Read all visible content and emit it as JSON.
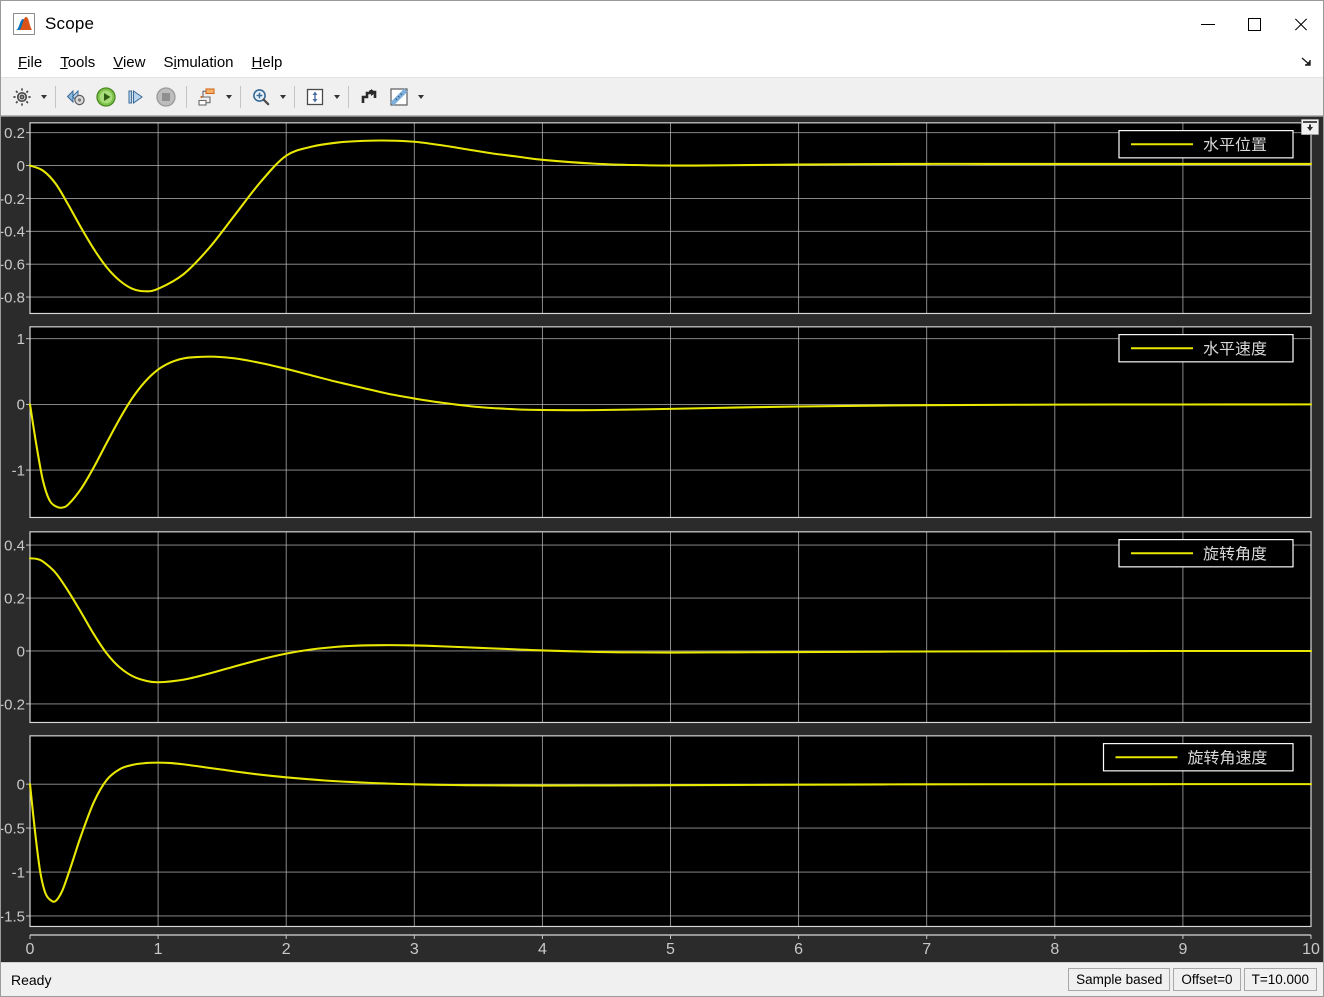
{
  "window": {
    "title": "Scope",
    "icon": "matlab-scope-icon",
    "controls": {
      "minimize": "minimize-button",
      "maximize": "maximize-button",
      "close": "close-button"
    }
  },
  "menubar": {
    "items": [
      {
        "label": "File",
        "mnemonic": "F"
      },
      {
        "label": "Tools",
        "mnemonic": "T"
      },
      {
        "label": "View",
        "mnemonic": "V"
      },
      {
        "label": "Simulation",
        "mnemonic": "S"
      },
      {
        "label": "Help",
        "mnemonic": "H"
      }
    ],
    "expand_icon": "menu-expand-arrow-icon"
  },
  "toolbar": {
    "buttons": [
      {
        "name": "configuration-properties-button",
        "icon": "gear-icon",
        "has_dropdown": true
      },
      {
        "name": "step-back-button",
        "icon": "rewind-gear-icon",
        "has_dropdown": false
      },
      {
        "name": "run-button",
        "icon": "play-icon",
        "has_dropdown": false
      },
      {
        "name": "step-forward-button",
        "icon": "step-forward-icon",
        "has_dropdown": false
      },
      {
        "name": "stop-button",
        "icon": "stop-icon",
        "has_dropdown": false
      },
      {
        "name": "signal-selection-button",
        "icon": "signal-blocks-icon",
        "has_dropdown": true
      },
      {
        "name": "zoom-button",
        "icon": "zoom-in-icon",
        "has_dropdown": true
      },
      {
        "name": "autoscale-button",
        "icon": "autoscale-icon",
        "has_dropdown": true
      },
      {
        "name": "scale-axes-limits-button",
        "icon": "axes-limits-icon",
        "has_dropdown": false
      },
      {
        "name": "cursor-measurements-button",
        "icon": "ruler-icon",
        "has_dropdown": true
      }
    ]
  },
  "statusbar": {
    "status": "Ready",
    "frame_mode": "Sample based",
    "offset": "Offset=0",
    "time": "T=10.000"
  },
  "scope": {
    "dock_icon": "dock-pin-icon",
    "background": "#000000",
    "surround": "#2b2b2b",
    "grid_color": "#b4b4b4",
    "trace_color": "#e8e800",
    "tick_text_color": "#c8c8c8"
  },
  "chart_data": [
    {
      "type": "line",
      "title": "",
      "xlabel": "",
      "ylabel": "",
      "legend": [
        "水平位置"
      ],
      "legend_position": "top-right",
      "grid": true,
      "xlim": [
        0,
        10
      ],
      "ylim": [
        -0.9,
        0.26
      ],
      "xticks": [
        0,
        1,
        2,
        3,
        4,
        5,
        6,
        7,
        8,
        9,
        10
      ],
      "yticks": [
        0.2,
        0,
        -0.2,
        -0.4,
        -0.6,
        -0.8
      ],
      "ytick_labels": [
        "0.2",
        "0",
        "-0.2",
        "-0.4",
        "-0.6",
        "-0.8"
      ],
      "series": [
        {
          "name": "水平位置",
          "color": "#e8e800",
          "x": [
            0,
            0.1,
            0.2,
            0.3,
            0.4,
            0.5,
            0.6,
            0.7,
            0.8,
            0.9,
            1.0,
            1.2,
            1.4,
            1.6,
            1.8,
            2.0,
            2.2,
            2.4,
            2.6,
            2.8,
            3.0,
            3.2,
            3.4,
            3.6,
            3.8,
            4.0,
            4.4,
            4.8,
            5.2,
            5.6,
            6.0,
            6.5,
            7.0,
            7.5,
            8.0,
            9.0,
            10.0
          ],
          "y": [
            0,
            -0.03,
            -0.11,
            -0.24,
            -0.38,
            -0.51,
            -0.62,
            -0.7,
            -0.75,
            -0.765,
            -0.75,
            -0.66,
            -0.5,
            -0.3,
            -0.1,
            0.06,
            0.115,
            0.14,
            0.15,
            0.152,
            0.145,
            0.125,
            0.1,
            0.075,
            0.055,
            0.035,
            0.012,
            0.002,
            0.0,
            0.003,
            0.006,
            0.009,
            0.01,
            0.01,
            0.01,
            0.01,
            0.01
          ]
        }
      ]
    },
    {
      "type": "line",
      "title": "",
      "xlabel": "",
      "ylabel": "",
      "legend": [
        "水平速度"
      ],
      "legend_position": "top-right",
      "grid": true,
      "xlim": [
        0,
        10
      ],
      "ylim": [
        -1.72,
        1.18
      ],
      "xticks": [
        0,
        1,
        2,
        3,
        4,
        5,
        6,
        7,
        8,
        9,
        10
      ],
      "yticks": [
        1,
        0,
        -1
      ],
      "ytick_labels": [
        "1",
        "0",
        "-1"
      ],
      "series": [
        {
          "name": "水平速度",
          "color": "#e8e800",
          "x": [
            0,
            0.05,
            0.1,
            0.15,
            0.2,
            0.25,
            0.3,
            0.4,
            0.5,
            0.6,
            0.7,
            0.8,
            0.9,
            1.0,
            1.1,
            1.2,
            1.3,
            1.45,
            1.6,
            1.8,
            2.0,
            2.2,
            2.4,
            2.6,
            2.8,
            3.0,
            3.2,
            3.5,
            3.8,
            4.0,
            4.3,
            4.6,
            5.0,
            5.5,
            6.0,
            7.0,
            8.0,
            9.0,
            10.0
          ],
          "y": [
            0,
            -0.62,
            -1.15,
            -1.45,
            -1.55,
            -1.57,
            -1.52,
            -1.28,
            -0.95,
            -0.58,
            -0.22,
            0.1,
            0.35,
            0.53,
            0.64,
            0.7,
            0.72,
            0.725,
            0.7,
            0.63,
            0.54,
            0.44,
            0.34,
            0.25,
            0.16,
            0.09,
            0.03,
            -0.04,
            -0.075,
            -0.085,
            -0.088,
            -0.082,
            -0.068,
            -0.048,
            -0.032,
            -0.012,
            -0.004,
            -0.001,
            0.0
          ]
        }
      ]
    },
    {
      "type": "line",
      "title": "",
      "xlabel": "",
      "ylabel": "",
      "legend": [
        "旋转角度"
      ],
      "legend_position": "top-right",
      "grid": true,
      "xlim": [
        0,
        10
      ],
      "ylim": [
        -0.27,
        0.45
      ],
      "xticks": [
        0,
        1,
        2,
        3,
        4,
        5,
        6,
        7,
        8,
        9,
        10
      ],
      "yticks": [
        0.4,
        0.2,
        0,
        -0.2
      ],
      "ytick_labels": [
        "0.4",
        "0.2",
        "0",
        "-0.2"
      ],
      "series": [
        {
          "name": "旋转角度",
          "color": "#e8e800",
          "x": [
            0,
            0.05,
            0.1,
            0.2,
            0.3,
            0.4,
            0.5,
            0.6,
            0.7,
            0.8,
            0.9,
            1.0,
            1.2,
            1.4,
            1.6,
            1.8,
            2.0,
            2.2,
            2.4,
            2.6,
            2.8,
            3.0,
            3.2,
            3.5,
            3.8,
            4.0,
            4.3,
            4.6,
            5.0,
            5.5,
            6.0,
            7.0,
            8.0,
            9.0,
            10.0
          ],
          "y": [
            0.35,
            0.348,
            0.338,
            0.295,
            0.225,
            0.145,
            0.062,
            -0.01,
            -0.062,
            -0.095,
            -0.112,
            -0.118,
            -0.108,
            -0.085,
            -0.058,
            -0.032,
            -0.01,
            0.006,
            0.016,
            0.021,
            0.022,
            0.021,
            0.018,
            0.012,
            0.006,
            0.002,
            -0.002,
            -0.005,
            -0.006,
            -0.005,
            -0.004,
            -0.002,
            -0.001,
            0.0,
            0.0
          ]
        }
      ]
    },
    {
      "type": "line",
      "title": "",
      "xlabel": "",
      "ylabel": "",
      "legend": [
        "旋转角速度"
      ],
      "legend_position": "top-right",
      "grid": true,
      "xlim": [
        0,
        10
      ],
      "ylim": [
        -1.62,
        0.55
      ],
      "xticks": [
        0,
        1,
        2,
        3,
        4,
        5,
        6,
        7,
        8,
        9,
        10
      ],
      "yticks": [
        0,
        -0.5,
        -1,
        -1.5
      ],
      "ytick_labels": [
        "0",
        "-0.5",
        "-1",
        "-1.5"
      ],
      "series": [
        {
          "name": "旋转角速度",
          "color": "#e8e800",
          "x": [
            0,
            0.04,
            0.08,
            0.12,
            0.16,
            0.2,
            0.25,
            0.3,
            0.35,
            0.4,
            0.5,
            0.6,
            0.7,
            0.8,
            0.9,
            1.0,
            1.1,
            1.2,
            1.35,
            1.5,
            1.7,
            1.9,
            2.1,
            2.3,
            2.5,
            2.8,
            3.0,
            3.3,
            3.6,
            4.0,
            4.5,
            5.0,
            5.5,
            6.0,
            7.0,
            8.0,
            9.0,
            10.0
          ],
          "y": [
            0,
            -0.55,
            -1.0,
            -1.24,
            -1.32,
            -1.33,
            -1.22,
            -1.02,
            -0.8,
            -0.58,
            -0.2,
            0.05,
            0.17,
            0.22,
            0.24,
            0.245,
            0.24,
            0.225,
            0.195,
            0.165,
            0.125,
            0.092,
            0.065,
            0.042,
            0.025,
            0.006,
            -0.002,
            -0.01,
            -0.014,
            -0.016,
            -0.015,
            -0.012,
            -0.009,
            -0.006,
            -0.002,
            -0.001,
            0.0,
            0.0
          ]
        }
      ]
    }
  ],
  "xaxis": {
    "labels": [
      "0",
      "1",
      "2",
      "3",
      "4",
      "5",
      "6",
      "7",
      "8",
      "9",
      "10"
    ]
  }
}
